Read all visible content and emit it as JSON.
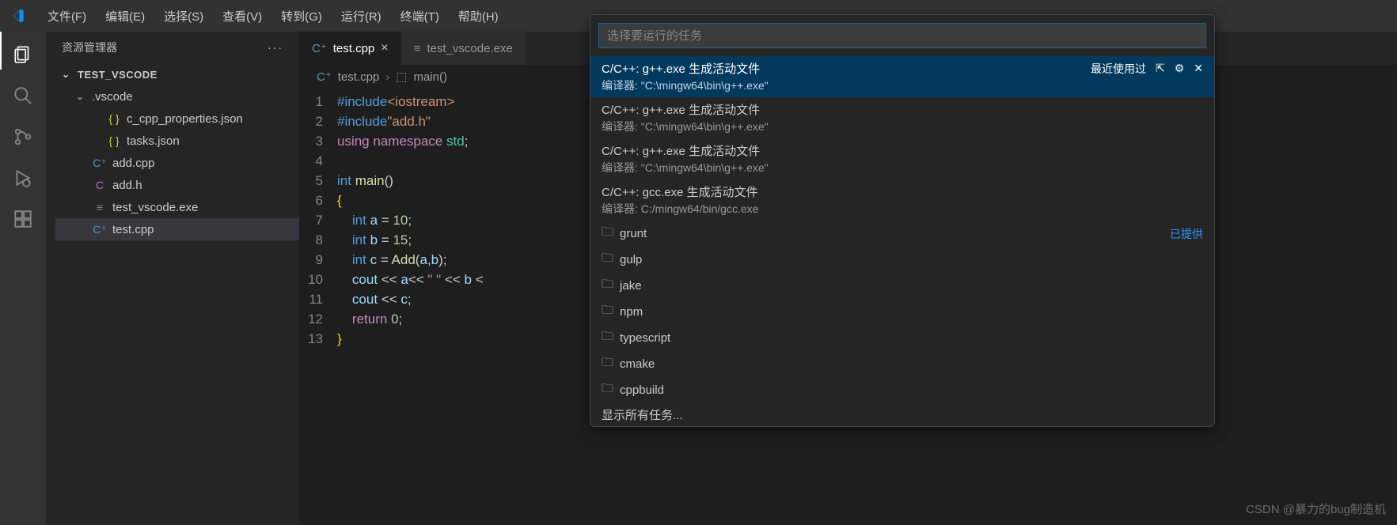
{
  "menu": [
    "文件(F)",
    "编辑(E)",
    "选择(S)",
    "查看(V)",
    "转到(G)",
    "运行(R)",
    "终端(T)",
    "帮助(H)"
  ],
  "sidebar": {
    "title": "资源管理器",
    "root": "TEST_VSCODE",
    "folder1": ".vscode",
    "files_vscode": [
      "c_cpp_properties.json",
      "tasks.json"
    ],
    "files_root": [
      {
        "name": "add.cpp",
        "cls": "icon-cpp",
        "glyph": "C⁺"
      },
      {
        "name": "add.h",
        "cls": "icon-c",
        "glyph": "C"
      },
      {
        "name": "test_vscode.exe",
        "cls": "icon-exe",
        "glyph": "≡"
      },
      {
        "name": "test.cpp",
        "cls": "icon-cpp",
        "glyph": "C⁺"
      }
    ]
  },
  "tabs": [
    {
      "name": "test.cpp",
      "active": true,
      "cls": "icon-cpp",
      "glyph": "C⁺"
    },
    {
      "name": "test_vscode.exe",
      "active": false,
      "cls": "icon-exe",
      "glyph": "≡"
    }
  ],
  "breadcrumb": {
    "file": "test.cpp",
    "symbol": "main()"
  },
  "code": [
    {
      "n": 1,
      "html": "<span class='inc'>#include</span><span class='str'>&lt;iostream&gt;</span>"
    },
    {
      "n": 2,
      "html": "<span class='inc'>#include</span><span class='str'>\"add.h\"</span>"
    },
    {
      "n": 3,
      "html": "<span class='kw'>using</span> <span class='kw'>namespace</span> <span class='ns'>std</span>;"
    },
    {
      "n": 4,
      "html": ""
    },
    {
      "n": 5,
      "html": "<span class='type'>int</span> <span class='fn'>main</span>()"
    },
    {
      "n": 6,
      "html": "<span class='brace'>{</span>"
    },
    {
      "n": 7,
      "html": "    <span class='type'>int</span> <span class='var'>a</span> = <span class='num'>10</span>;"
    },
    {
      "n": 8,
      "html": "    <span class='type'>int</span> <span class='var'>b</span> = <span class='num'>15</span>;"
    },
    {
      "n": 9,
      "html": "    <span class='type'>int</span> <span class='var'>c</span> = <span class='fn'>Add</span>(<span class='var'>a</span>,<span class='var'>b</span>);"
    },
    {
      "n": 10,
      "html": "    <span class='var'>cout</span> &lt;&lt; <span class='var'>a</span>&lt;&lt; <span class='str'>\" \"</span> &lt;&lt; <span class='var'>b</span> &lt;"
    },
    {
      "n": 11,
      "html": "    <span class='var'>cout</span> &lt;&lt; <span class='var'>c</span>;"
    },
    {
      "n": 12,
      "html": "    <span class='kw'>return</span> <span class='num'>0</span>;"
    },
    {
      "n": 13,
      "html": "<span class='brace'>}</span>"
    }
  ],
  "quickpick": {
    "placeholder": "选择要运行的任务",
    "recent_label": "最近使用过",
    "provided_label": "已提供",
    "tasks": [
      {
        "title": "C/C++: g++.exe 生成活动文件",
        "detail": "编译器: \"C:\\mingw64\\bin\\g++.exe\"",
        "selected": true,
        "recent": true,
        "actions": true
      },
      {
        "title": "C/C++: g++.exe 生成活动文件",
        "detail": "编译器: \"C:\\mingw64\\bin\\g++.exe\""
      },
      {
        "title": "C/C++: g++.exe 生成活动文件",
        "detail": "编译器: \"C:\\mingw64\\bin\\g++.exe\""
      },
      {
        "title": "C/C++: gcc.exe 生成活动文件",
        "detail": "编译器: C:/mingw64/bin/gcc.exe"
      }
    ],
    "providers": [
      "grunt",
      "gulp",
      "jake",
      "npm",
      "typescript",
      "cmake",
      "cppbuild"
    ],
    "show_all": "显示所有任务..."
  },
  "watermark": "CSDN @暴力的bug制造机"
}
